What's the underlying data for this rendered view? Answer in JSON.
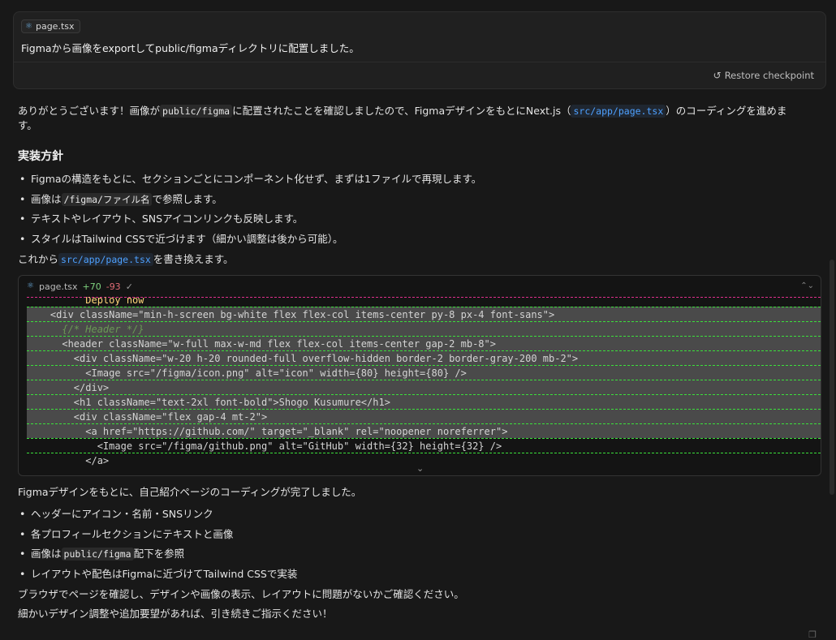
{
  "user_message": {
    "file_chip": "page.tsx",
    "text": "Figmaから画像をexportしてpublic/figmaディレクトリに配置しました。",
    "restore_label": "Restore checkpoint"
  },
  "assistant": {
    "intro_prefix": "ありがとうございます！画像が",
    "intro_code": "public/figma",
    "intro_middle": "に配置されたことを確認しましたので、FigmaデザインをもとにNext.js（",
    "intro_link": "src/app/page.tsx",
    "intro_suffix": "）のコーディングを進めま",
    "intro_line2": "す。",
    "heading": "実装方針",
    "bullets1": [
      {
        "text": "Figmaの構造をもとに、セクションごとにコンポーネント化せず、まずは1ファイルで再現します。"
      },
      {
        "prefix": "画像は",
        "code": "/figma/ファイル名",
        "suffix": "で参照します。"
      },
      {
        "text": "テキストやレイアウト、SNSアイコンリンクも反映します。"
      },
      {
        "text": "スタイルはTailwind CSSで近づけます（細かい調整は後から可能）。"
      }
    ],
    "rewrite_prefix": "これから",
    "rewrite_link": "src/app/page.tsx",
    "rewrite_suffix": "を書き換えます。",
    "code_block": {
      "filename": "page.tsx",
      "added": "+70",
      "removed": "-93",
      "lines": [
        "          Deploy now",
        "    <div className=\"min-h-screen bg-white flex flex-col items-center py-8 px-4 font-sans\">",
        "      {/* Header */}",
        "      <header className=\"w-full max-w-md flex flex-col items-center gap-2 mb-8\">",
        "        <div className=\"w-20 h-20 rounded-full overflow-hidden border-2 border-gray-200 mb-2\">",
        "          <Image src=\"/figma/icon.png\" alt=\"icon\" width={80} height={80} />",
        "        </div>",
        "        <h1 className=\"text-2xl font-bold\">Shogo Kusumure</h1>",
        "        <div className=\"flex gap-4 mt-2\">",
        "          <a href=\"https://github.com/\" target=\"_blank\" rel=\"noopener noreferrer\">",
        "            <Image src=\"/figma/github.png\" alt=\"GitHub\" width={32} height={32} />",
        "          </a>"
      ]
    },
    "summary": "Figmaデザインをもとに、自己紹介ページのコーディングが完了しました。",
    "bullets2": [
      {
        "text": "ヘッダーにアイコン・名前・SNSリンク"
      },
      {
        "text": "各プロフィールセクションにテキストと画像"
      },
      {
        "prefix": "画像は",
        "code": "public/figma",
        "suffix": "配下を参照"
      },
      {
        "text": "レイアウトや配色はFigmaに近づけてTailwind CSSで実装"
      }
    ],
    "closing1": "ブラウザでページを確認し、デザインや画像の表示、レイアウトに問題がないかご確認ください。",
    "closing2": "細かいデザイン調整や追加要望があれば、引き続きご指示ください！"
  },
  "icons": {
    "react": "react-icon",
    "restore": "restore-icon",
    "check": "check-icon",
    "collapse": "collapse-icon",
    "expand": "chevron-down-icon",
    "copy": "copy-icon"
  }
}
